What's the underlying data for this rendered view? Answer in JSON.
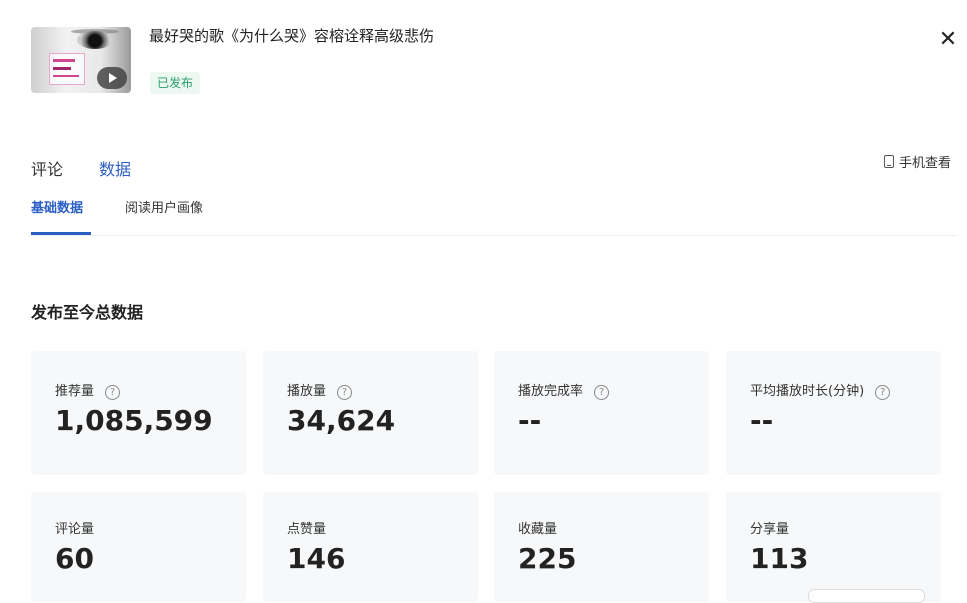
{
  "video": {
    "title": "最好哭的歌《为什么哭》容榕诠释高级悲伤",
    "status": "已发布"
  },
  "tabs": [
    {
      "label": "评论",
      "active": false
    },
    {
      "label": "数据",
      "active": true
    }
  ],
  "phone_view_label": "手机查看",
  "subtabs": [
    {
      "label": "基础数据",
      "active": true
    },
    {
      "label": "阅读用户画像",
      "active": false
    }
  ],
  "section_title": "发布至今总数据",
  "metrics": [
    {
      "label": "推荐量",
      "value": "1,085,599",
      "help": true
    },
    {
      "label": "播放量",
      "value": "34,624",
      "help": true
    },
    {
      "label": "播放完成率",
      "value": "--",
      "help": true
    },
    {
      "label": "平均播放时长(分钟)",
      "value": "--",
      "help": true
    },
    {
      "label": "评论量",
      "value": "60",
      "help": false
    },
    {
      "label": "点赞量",
      "value": "146",
      "help": false
    },
    {
      "label": "收藏量",
      "value": "225",
      "help": false
    },
    {
      "label": "分享量",
      "value": "113",
      "help": false
    }
  ],
  "icons": {
    "close": "close-icon",
    "play": "play-icon",
    "phone": "phone-icon",
    "help": "help-icon"
  },
  "colors": {
    "accent": "#2b5fc6",
    "published": "#2a9d6c",
    "card_bg": "#f7f8fa"
  }
}
